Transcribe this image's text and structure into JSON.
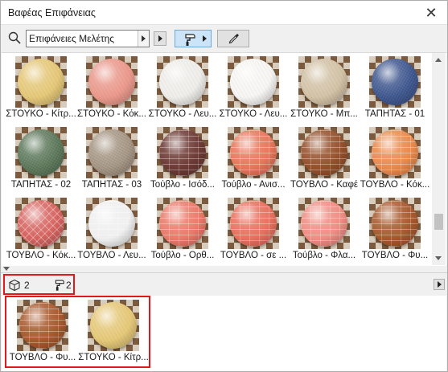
{
  "window": {
    "title": "Βαφέας Επιφάνειας",
    "close_glyph": "✕"
  },
  "toolbar": {
    "search_value": "Επιφάνειες Μελέτης",
    "search_icon": "search-icon",
    "paint_icon": "paint-roller-icon",
    "eyedropper_icon": "eyedropper-icon"
  },
  "surfaces": [
    {
      "label": "ΣΤΟΥΚΟ - Κίτρ...",
      "color": "#e6c97a",
      "texture": "plaster"
    },
    {
      "label": "ΣΤΟΥΚΟ - Κόκ...",
      "color": "#ec9b8e",
      "texture": "plaster"
    },
    {
      "label": "ΣΤΟΥΚΟ - Λευ...",
      "color": "#f0eeea",
      "texture": "plaster"
    },
    {
      "label": "ΣΤΟΥΚΟ - Λευ...",
      "color": "#f7f6f4",
      "texture": "plaster"
    },
    {
      "label": "ΣΤΟΥΚΟ - Μπ...",
      "color": "#d4c4a8",
      "texture": "plaster"
    },
    {
      "label": "ΤΑΠΗΤΑΣ - 01",
      "color": "#3f5891",
      "texture": "carpet"
    },
    {
      "label": "ΤΑΠΗΤΑΣ - 02",
      "color": "#5e7a5c",
      "texture": "carpet"
    },
    {
      "label": "ΤΑΠΗΤΑΣ - 03",
      "color": "#a89886",
      "texture": "carpet"
    },
    {
      "label": "Τούβλο - Ισόδ...",
      "color": "#6e3a35",
      "texture": "brick"
    },
    {
      "label": "Τούβλο - Ανισ...",
      "color": "#e7765a",
      "texture": "brick"
    },
    {
      "label": "ΤΟΥΒΛΟ - Καφέ",
      "color": "#95502b",
      "texture": "brick"
    },
    {
      "label": "ΤΟΥΒΛΟ - Κόκ...",
      "color": "#e98a4d",
      "texture": "brick"
    },
    {
      "label": "ΤΟΥΒΛΟ - Κόκ...",
      "color": "#d5635f",
      "texture": "herringbone"
    },
    {
      "label": "ΤΟΥΒΛΟ - Λευ...",
      "color": "#efefef",
      "texture": "brick"
    },
    {
      "label": "Τούβλο - Ορθ...",
      "color": "#ea7a69",
      "texture": "brick"
    },
    {
      "label": "ΤΟΥΒΛΟ - σε ...",
      "color": "#e8705e",
      "texture": "brick"
    },
    {
      "label": "Τούβλο - Φλα...",
      "color": "#ef8d83",
      "texture": "brick"
    },
    {
      "label": "ΤΟΥΒΛΟ - Φυ...",
      "color": "#a8592d",
      "texture": "brick"
    }
  ],
  "selection": {
    "elements_icon": "cube-icon",
    "elements_count": "2",
    "surfaces_icon": "paint-roller-icon",
    "surfaces_count": "2",
    "items": [
      {
        "label": "ΤΟΥΒΛΟ - Φυ...",
        "color": "#a8592d",
        "texture": "brick"
      },
      {
        "label": "ΣΤΟΥΚΟ - Κίτρ...",
        "color": "#e6c97a",
        "texture": "plaster"
      }
    ]
  }
}
